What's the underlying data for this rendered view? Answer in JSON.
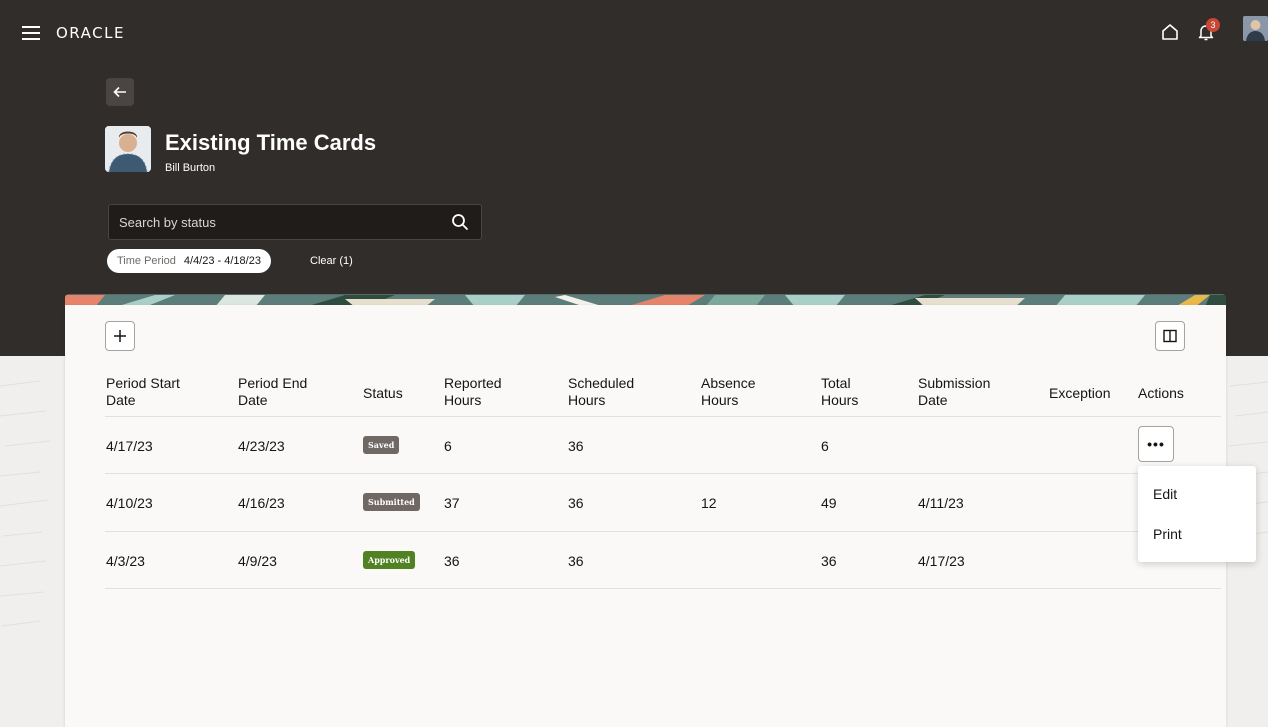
{
  "header": {
    "logo": "ORACLE",
    "notification_count": "3"
  },
  "page": {
    "title": "Existing Time Cards",
    "person_name": "Bill Burton"
  },
  "search": {
    "placeholder": "Search by status",
    "value": ""
  },
  "filter": {
    "chip_label": "Time Period",
    "chip_value": "4/4/23 - 4/18/23",
    "clear_label": "Clear (1)"
  },
  "table": {
    "columns": [
      {
        "line1": "Period Start",
        "line2": "Date"
      },
      {
        "line1": "Period End",
        "line2": "Date"
      },
      {
        "line1": "Status",
        "line2": ""
      },
      {
        "line1": "Reported",
        "line2": "Hours"
      },
      {
        "line1": "Scheduled",
        "line2": "Hours"
      },
      {
        "line1": "Absence",
        "line2": "Hours"
      },
      {
        "line1": "Total",
        "line2": "Hours"
      },
      {
        "line1": "Submission",
        "line2": "Date"
      },
      {
        "line1": "Exception",
        "line2": ""
      },
      {
        "line1": "Actions",
        "line2": ""
      }
    ],
    "rows": [
      {
        "start": "4/17/23",
        "end": "4/23/23",
        "status": "Saved",
        "reported": "6",
        "scheduled": "36",
        "absence": "",
        "total": "6",
        "submission": ""
      },
      {
        "start": "4/10/23",
        "end": "4/16/23",
        "status": "Submitted",
        "reported": "37",
        "scheduled": "36",
        "absence": "12",
        "total": "49",
        "submission": "4/11/23"
      },
      {
        "start": "4/3/23",
        "end": "4/9/23",
        "status": "Approved",
        "reported": "36",
        "scheduled": "36",
        "absence": "",
        "total": "36",
        "submission": "4/17/23"
      }
    ]
  },
  "actions_menu": {
    "more_label": "•••",
    "items": [
      "Edit",
      "Print"
    ]
  },
  "colors": {
    "header_bg": "#312d2a",
    "saved": "#6f6864",
    "submitted": "#6f6864",
    "approved": "#508223",
    "notification": "#c74634"
  }
}
